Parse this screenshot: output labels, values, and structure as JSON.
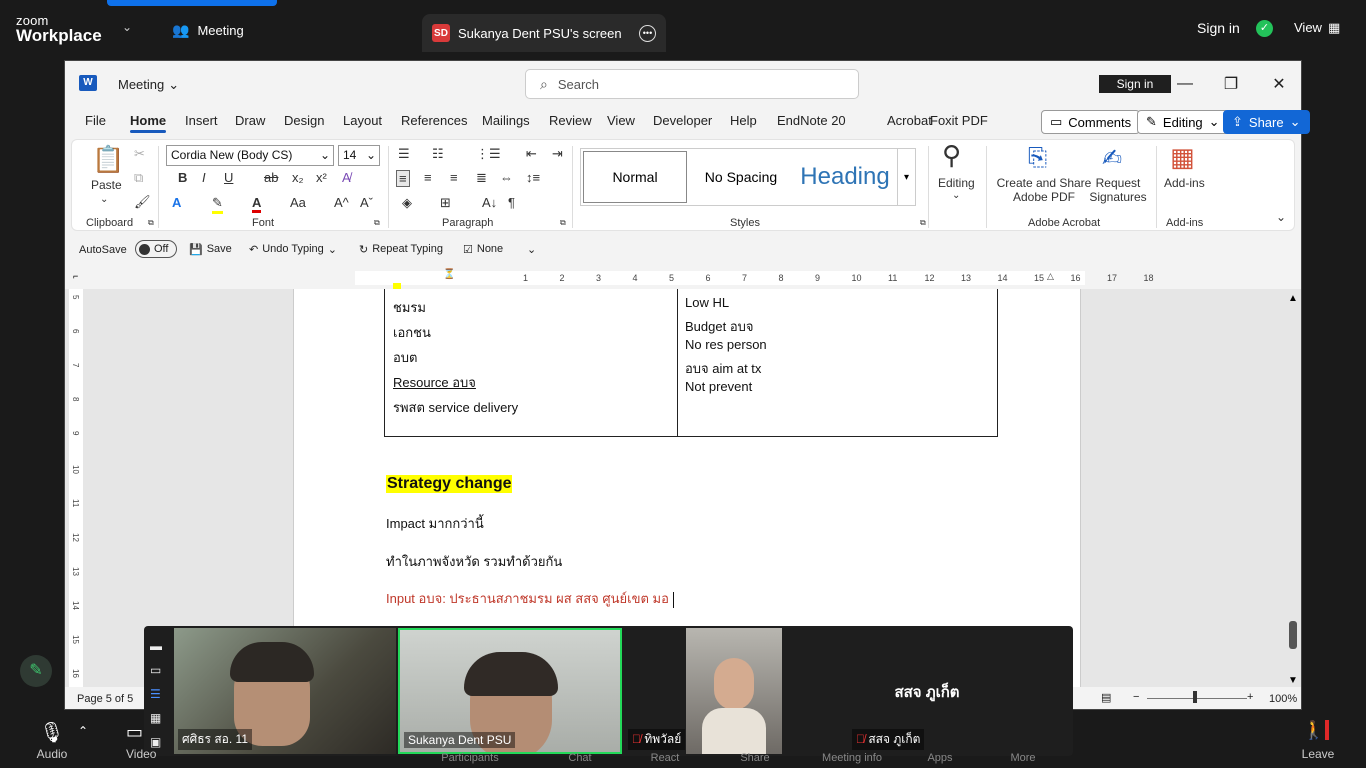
{
  "zoom": {
    "logo_line1": "zoom",
    "logo_line2": "Workplace",
    "meeting_label": "Meeting",
    "share_avatar": "SD",
    "share_tab_label": "Sukanya Dent PSU's screen",
    "sign_in": "Sign in",
    "view_label": "View",
    "bottom": {
      "audio": "Audio",
      "video": "Video",
      "participants": "Participants",
      "chat": "Chat",
      "react": "React",
      "share": "Share",
      "meeting_info": "Meeting info",
      "apps": "Apps",
      "more": "More",
      "leave": "Leave"
    }
  },
  "word": {
    "title_menu": "Meeting",
    "search_placeholder": "Search",
    "sign_in": "Sign in",
    "tabs": [
      "File",
      "Home",
      "Insert",
      "Draw",
      "Design",
      "Layout",
      "References",
      "Mailings",
      "Review",
      "View",
      "Developer",
      "Help",
      "EndNote 20",
      "Acrobat",
      "Foxit PDF"
    ],
    "comments": "Comments",
    "editing_mode": "Editing",
    "share": "Share",
    "ribbon": {
      "paste": "Paste",
      "clipboard": "Clipboard",
      "font_name": "Cordia New (Body CS)",
      "font_size": "14",
      "font": "Font",
      "paragraph": "Paragraph",
      "styles": "Styles",
      "style_normal": "Normal",
      "style_nospacing": "No Spacing",
      "style_heading": "Heading",
      "editing": "Editing",
      "create_share_1": "Create and Share",
      "create_share_2": "Adobe PDF",
      "request_1": "Request",
      "request_2": "Signatures",
      "adobe_acrobat": "Adobe Acrobat",
      "addins_btn": "Add-ins",
      "addins_group": "Add-ins"
    },
    "qat": {
      "autosave": "AutoSave",
      "off": "Off",
      "save": "Save",
      "undo": "Undo Typing",
      "repeat": "Repeat Typing",
      "none": "None"
    },
    "ruler_numbers": [
      "1",
      "2",
      "3",
      "4",
      "5",
      "6",
      "7",
      "8",
      "9",
      "10",
      "11",
      "12",
      "13",
      "14",
      "15",
      "16",
      "17",
      "18"
    ],
    "vruler_numbers": [
      "5",
      "6",
      "7",
      "8",
      "9",
      "10",
      "11",
      "12",
      "13",
      "14",
      "15",
      "16"
    ],
    "table_left": [
      "ชมรม",
      "เอกชน",
      "อบต",
      "Resource  อบจ",
      "รพสต service delivery"
    ],
    "table_right": [
      "Low HL",
      "Budget อบจ",
      "No res person",
      "อบจ aim at tx",
      "Not prevent"
    ],
    "heading": "Strategy change",
    "para1": "Impact มากกว่านี้",
    "para2": "ทำในภาพจังหวัด รวมทำด้วยกัน",
    "para3": "Input อบจ: ประธานสภาชมรม ผส สสจ ศูนย์เขต มอ",
    "status_page": "Page 5 of 5",
    "zoom_pct": "100%"
  },
  "participants": [
    {
      "name": "ศศิธร สอ. 11"
    },
    {
      "name": "Sukanya Dent PSU"
    },
    {
      "name": "ทิพวัลย์"
    },
    {
      "name": "สสจ ภูเก็ต"
    }
  ],
  "participant_big_name": "สสจ ภูเก็ต",
  "colors": {
    "zoom_bg": "#1a1a1a",
    "word_accent": "#185abd",
    "share_btn": "#1267d6",
    "active_speaker": "#23d959",
    "highlight": "#ffff00",
    "red_text": "#c0392b"
  }
}
